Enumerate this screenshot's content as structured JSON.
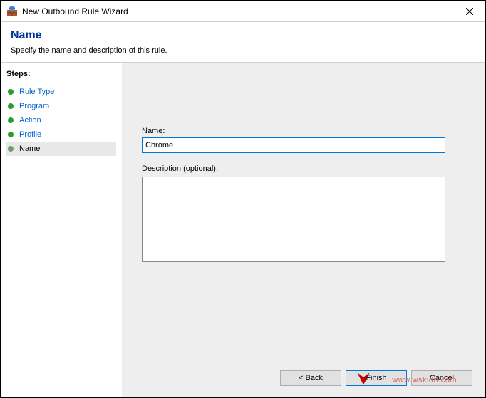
{
  "window": {
    "title": "New Outbound Rule Wizard",
    "close": "✕"
  },
  "header": {
    "title": "Name",
    "subtitle": "Specify the name and description of this rule."
  },
  "sidebar": {
    "title": "Steps:",
    "items": [
      {
        "label": "Rule Type"
      },
      {
        "label": "Program"
      },
      {
        "label": "Action"
      },
      {
        "label": "Profile"
      },
      {
        "label": "Name"
      }
    ]
  },
  "form": {
    "name_label": "Name:",
    "name_value": "Chrome",
    "desc_label": "Description (optional):",
    "desc_value": ""
  },
  "buttons": {
    "back": "< Back",
    "finish": "Finish",
    "cancel": "Cancel"
  },
  "watermark": "www.wskidn.com"
}
